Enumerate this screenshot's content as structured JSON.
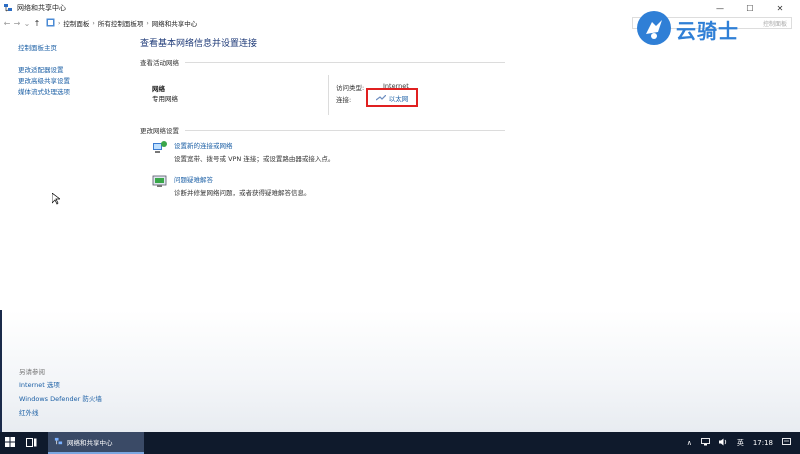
{
  "window": {
    "title": "网络和共享中心",
    "minimize": "—",
    "maximize": "☐",
    "close": "✕"
  },
  "addressbar": {
    "back": "←",
    "forward": "→",
    "down": "⌄",
    "up": "↑",
    "crumbs": [
      "控制面板",
      "所有控制面板项",
      "网络和共享中心"
    ],
    "search_partial": "控制面板"
  },
  "sidebar": {
    "items": [
      "控制面板主页",
      "更改适配器设置",
      "更改高级共享设置",
      "媒体流式处理选项"
    ]
  },
  "main": {
    "heading": "查看基本网络信息并设置连接",
    "active_section": "查看活动网络",
    "network_name": "网络",
    "network_type": "专用网络",
    "access_label": "访问类型:",
    "access_value": "Internet",
    "connection_label": "连接:",
    "connection_value": "以太网",
    "change_section": "更改网络设置",
    "tasks": [
      {
        "link": "设置新的连接或网络",
        "desc": "设置宽带、拨号或 VPN 连接；或设置路由器或接入点。"
      },
      {
        "link": "问题疑难解答",
        "desc": "诊断并修复网络问题，或者获得疑难解答信息。"
      }
    ]
  },
  "see_also": {
    "heading": "另请参阅",
    "links": [
      "Internet 选项",
      "Windows Defender 防火墙",
      "红外线"
    ]
  },
  "taskbar": {
    "app_label": "网络和共享中心",
    "tray_chevron": "∧",
    "ime": "英",
    "time": "17:18"
  },
  "watermark": {
    "text": "云骑士",
    "small": "…控制面板"
  },
  "colors": {
    "link": "#1b5fa5",
    "heading": "#1e3a78",
    "highlight_box": "#e02020",
    "taskbar": "#0f1a2c"
  }
}
